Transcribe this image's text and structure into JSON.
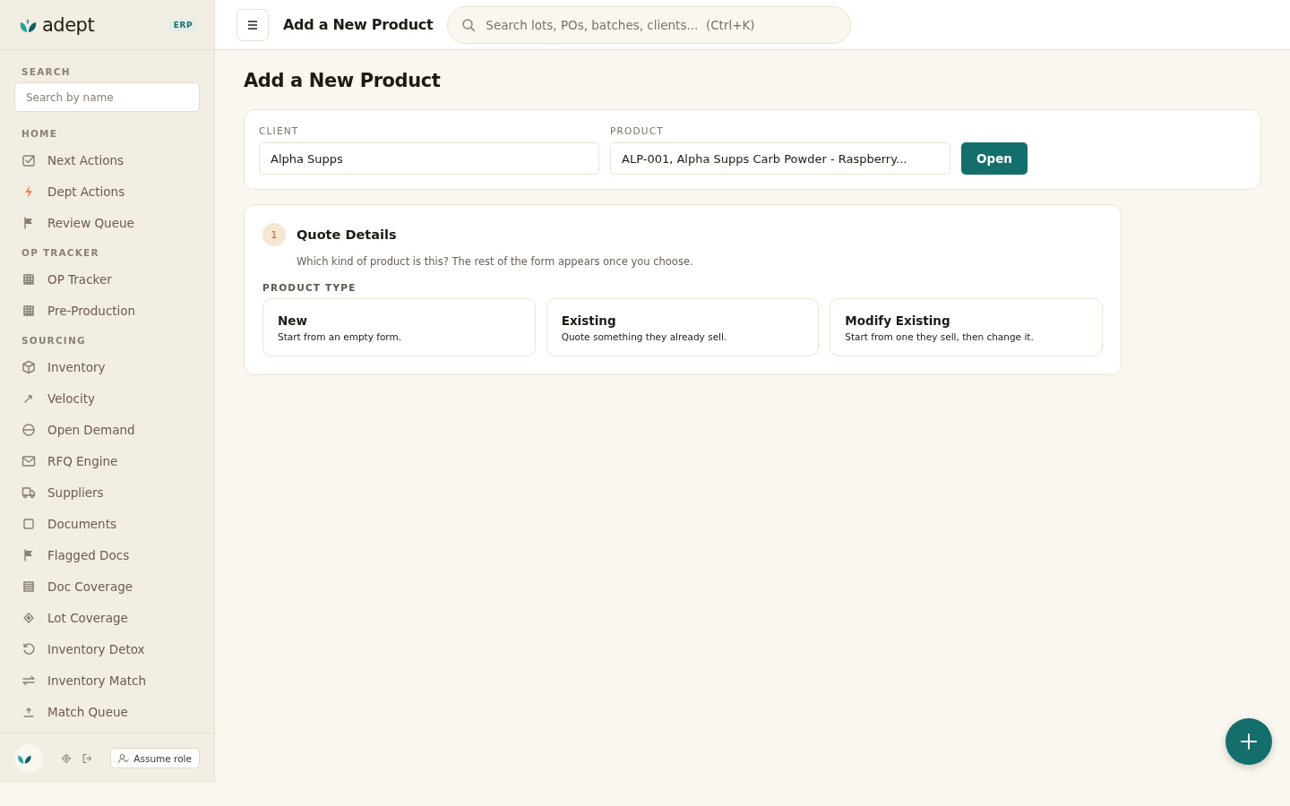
{
  "brand": {
    "name": "adept",
    "badge": "ERP"
  },
  "sidebar": {
    "search": {
      "label": "SEARCH",
      "placeholder": "Search by name"
    },
    "sections": [
      {
        "title": "HOME",
        "items": [
          {
            "label": "Next Actions"
          },
          {
            "label": "Dept Actions"
          },
          {
            "label": "Review Queue"
          }
        ]
      },
      {
        "title": "OP TRACKER",
        "items": [
          {
            "label": "OP Tracker"
          },
          {
            "label": "Pre-Production"
          }
        ]
      },
      {
        "title": "SOURCING",
        "items": [
          {
            "label": "Inventory"
          },
          {
            "label": "Velocity"
          },
          {
            "label": "Open Demand"
          },
          {
            "label": "RFQ Engine"
          },
          {
            "label": "Suppliers"
          },
          {
            "label": "Documents"
          },
          {
            "label": "Flagged Docs"
          },
          {
            "label": "Doc Coverage"
          },
          {
            "label": "Lot Coverage"
          },
          {
            "label": "Inventory Detox"
          },
          {
            "label": "Inventory Match"
          },
          {
            "label": "Match Queue"
          }
        ]
      }
    ],
    "footer": {
      "assume_role": "Assume role"
    }
  },
  "topbar": {
    "title": "Add a New Product",
    "search_placeholder": "Search lots, POs, batches, clients...  (Ctrl+K)"
  },
  "page": {
    "title": "Add a New Product",
    "picker": {
      "client_label": "CLIENT",
      "client_value": "Alpha Supps",
      "product_label": "PRODUCT",
      "product_value": "ALP-001, Alpha Supps Carb Powder - Raspberry...",
      "open_button": "Open"
    },
    "step": {
      "number": "1",
      "title": "Quote Details",
      "hint": "Which kind of product is this? The rest of the form appears once you choose.",
      "type_label": "PRODUCT TYPE",
      "options": [
        {
          "title": "New",
          "description": "Start from an empty form.",
          "selected": false
        },
        {
          "title": "Existing",
          "description": "Quote something they already sell.",
          "selected": false
        },
        {
          "title": "Modify Existing",
          "description": "Start from one they sell, then change it.",
          "selected": false
        }
      ]
    }
  }
}
